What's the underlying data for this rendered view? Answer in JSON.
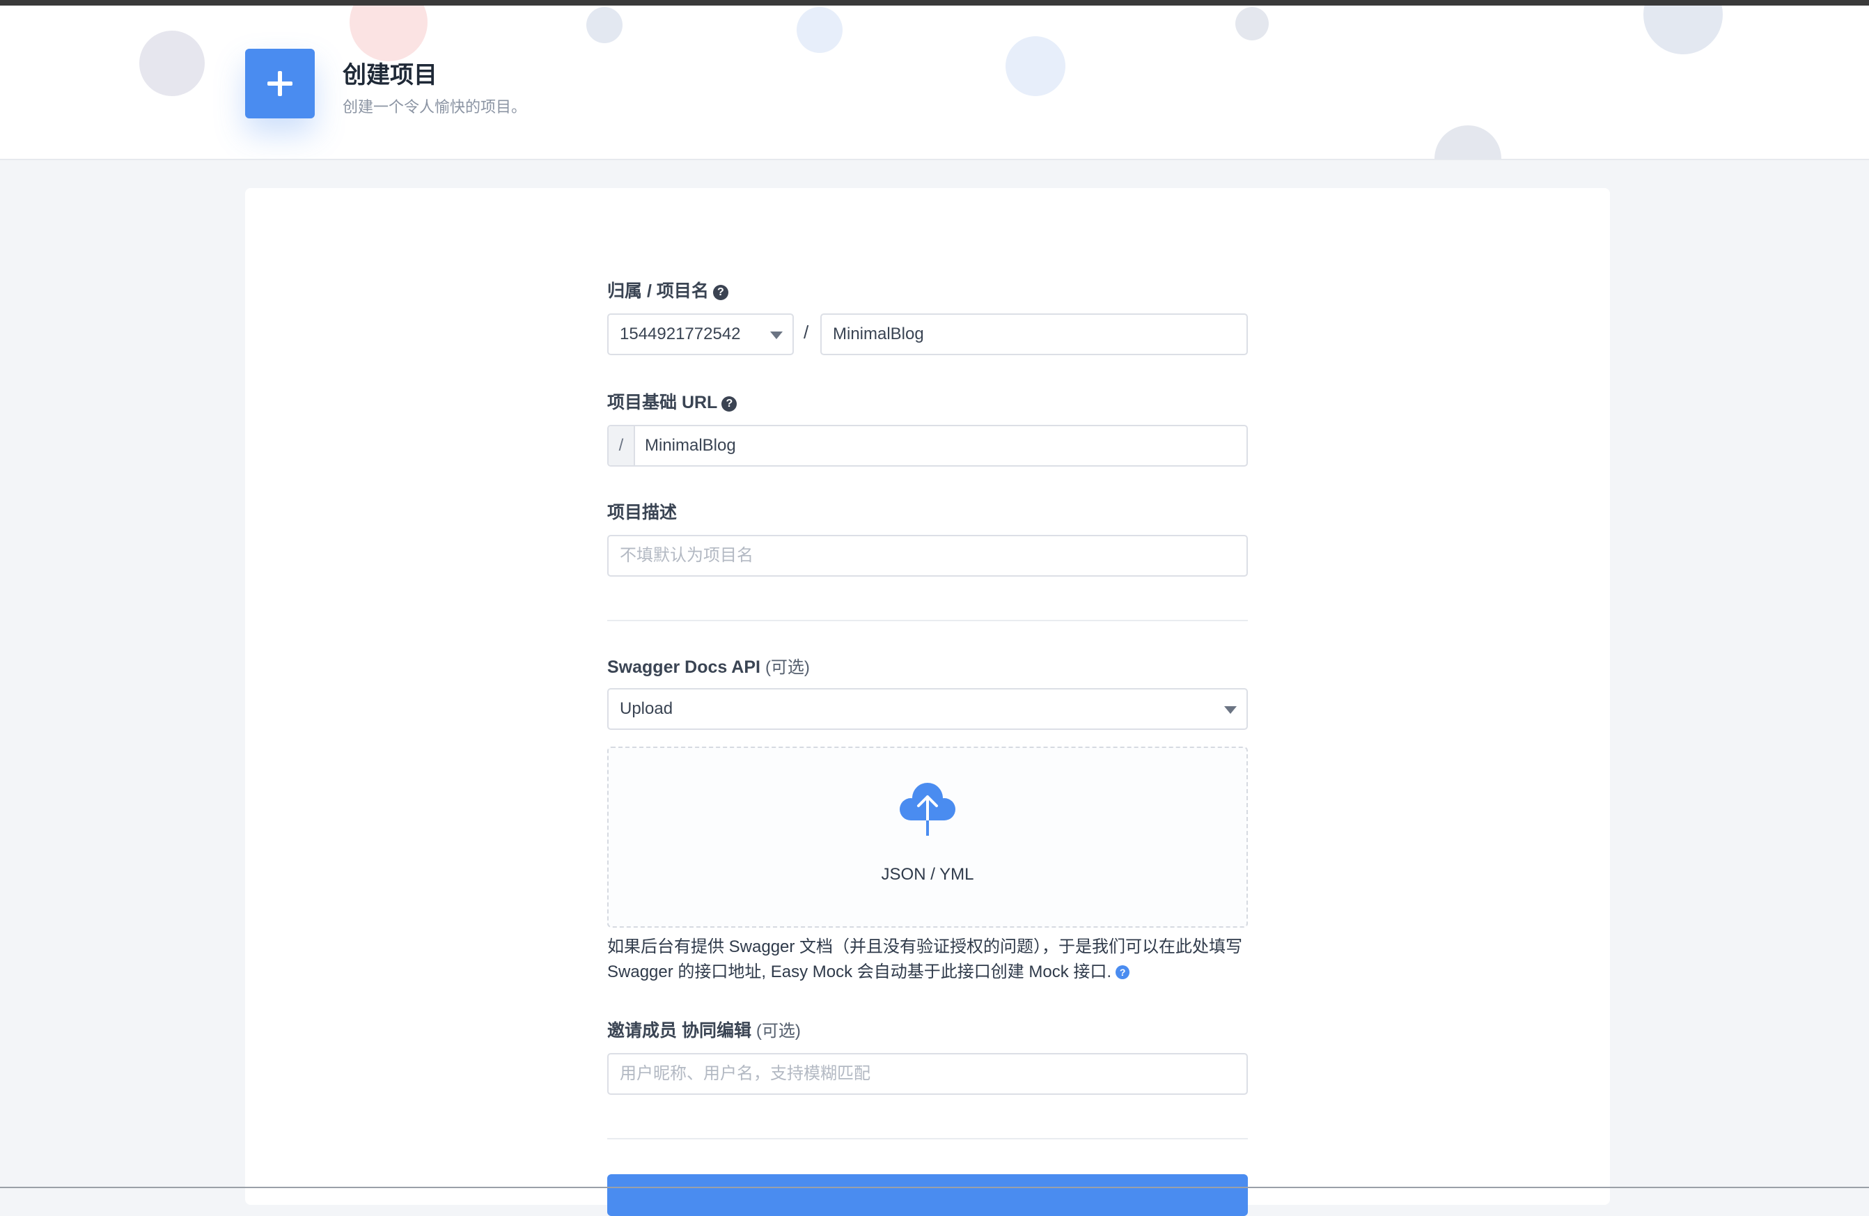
{
  "header": {
    "title": "创建项目",
    "subtitle": "创建一个令人愉快的项目。",
    "accent": "#4a8cf0"
  },
  "form": {
    "owner_label": "归属 / 项目名",
    "owner_value": "1544921772542",
    "separator": "/",
    "project_name": "MinimalBlog",
    "base_url_label": "项目基础 URL",
    "base_url_prefix": "/",
    "base_url_value": "MinimalBlog",
    "description_label": "项目描述",
    "description_placeholder": "不填默认为项目名",
    "swagger_label": "Swagger Docs API",
    "swagger_optional": "(可选)",
    "swagger_mode": "Upload",
    "upload_text": "JSON / YML",
    "swagger_help": "如果后台有提供 Swagger 文档（并且没有验证授权的问题），于是我们可以在此处填写 Swagger 的接口地址, Easy Mock 会自动基于此接口创建 Mock 接口.",
    "invite_label": "邀请成员 协同编辑",
    "invite_optional": "(可选)",
    "invite_placeholder": "用户昵称、用户名，支持模糊匹配",
    "help_glyph": "?"
  },
  "icons": {
    "header": "plus-icon",
    "upload": "cloud-upload-icon",
    "help": "question-circle-icon",
    "dropdown": "caret-down-icon"
  }
}
